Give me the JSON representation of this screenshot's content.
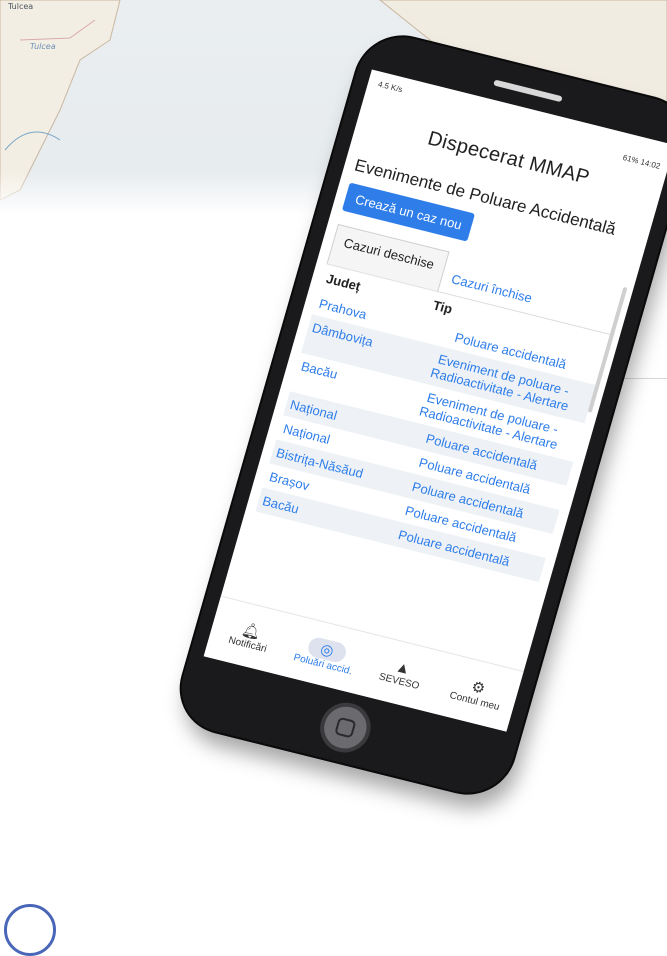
{
  "map": {
    "labels": [
      "Tulcea",
      "Tulcea"
    ]
  },
  "status_bar": {
    "left": "4.5 K/s",
    "right": "61% 14:02"
  },
  "app": {
    "title": "Dispecerat MMAP"
  },
  "section": {
    "title": "Evenimente de Poluare Accidentală",
    "create_button": "Crează un caz nou"
  },
  "tabs": [
    {
      "label": "Cazuri deschise",
      "active": true
    },
    {
      "label": "Cazuri închise",
      "active": false
    }
  ],
  "table": {
    "headers": [
      "Județ",
      "Tip"
    ],
    "rows": [
      {
        "county": "Prahova",
        "type": "Poluare accidentală"
      },
      {
        "county": "Dâmbovița",
        "type": "Eveniment de poluare - Radioactivitate - Alertare"
      },
      {
        "county": "Bacău",
        "type": "Eveniment de poluare - Radioactivitate - Alertare"
      },
      {
        "county": "Național",
        "type": "Poluare accidentală"
      },
      {
        "county": "Național",
        "type": "Poluare accidentală"
      },
      {
        "county": "Bistrița-Năsăud",
        "type": "Poluare accidentală"
      },
      {
        "county": "Brașov",
        "type": "Poluare accidentală"
      },
      {
        "county": "Bacău",
        "type": "Poluare accidentală"
      }
    ]
  },
  "bottom_nav": [
    {
      "label": "Notificări",
      "icon": "bell-icon",
      "active": false
    },
    {
      "label": "Poluări accid.",
      "icon": "radiation-icon",
      "active": true
    },
    {
      "label": "SEVESO",
      "icon": "warning-icon",
      "active": false
    },
    {
      "label": "Contul meu",
      "icon": "gear-icon",
      "active": false
    }
  ],
  "colors": {
    "accent": "#2e7de9",
    "phone_body": "#1a1a1c",
    "row_stripe": "#eef2f6"
  }
}
